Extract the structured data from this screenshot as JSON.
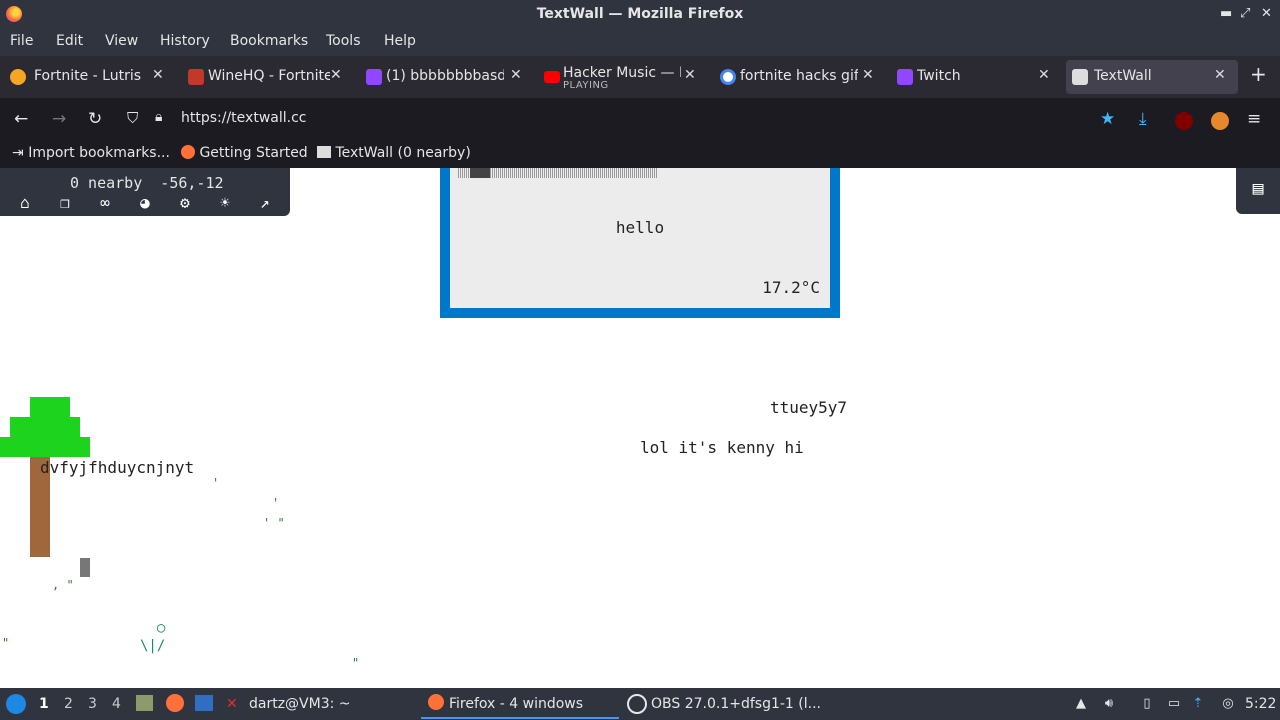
{
  "window": {
    "title": "TextWall — Mozilla Firefox"
  },
  "menu": {
    "items": [
      "File",
      "Edit",
      "View",
      "History",
      "Bookmarks",
      "Tools",
      "Help"
    ]
  },
  "tabs": [
    {
      "label": "Fortnite - Lutris",
      "icon": "lutris-icon",
      "color": "#f5a623"
    },
    {
      "label": "WineHQ - Fortnite",
      "icon": "winehq-icon",
      "color": "#c0392b"
    },
    {
      "label": "(1) bbbbbbbbasdf",
      "icon": "twitch-icon",
      "color": "#9146ff"
    },
    {
      "label": "Hacker Music — D",
      "sub": "PLAYING",
      "icon": "youtube-icon",
      "color": "#ff0000"
    },
    {
      "label": "fortnite hacks gif",
      "icon": "google-icon",
      "color": "#4285f4"
    },
    {
      "label": "Twitch",
      "icon": "twitch-icon",
      "color": "#9146ff"
    },
    {
      "label": "TextWall",
      "icon": "textwall-icon",
      "color": "#dddddd",
      "active": true
    }
  ],
  "nav": {
    "url": "https://textwall.cc"
  },
  "bookmarks": [
    {
      "label": "Import bookmarks...",
      "icon": "import-icon"
    },
    {
      "label": "Getting Started",
      "icon": "firefox-icon"
    },
    {
      "label": "TextWall (0 nearby)",
      "icon": "textwall-icon"
    }
  ],
  "page": {
    "hud": {
      "status": "0 nearby  -56,-12"
    },
    "weather": {
      "text": "hello",
      "temp": "17.2°C"
    },
    "texts": {
      "t1": "ttuey5y7",
      "t2": "lol it's kenny hi",
      "t3": "dvfyjfhduycnjnyt"
    },
    "flower": "  ○\n\\|/"
  },
  "taskbar": {
    "workspaces": [
      "1",
      "2",
      "3",
      "4"
    ],
    "terminal": "dartz@VM3: ~",
    "firefox": "Firefox - 4 windows",
    "obs": "OBS 27.0.1+dfsg1-1 (l...",
    "clock": "5:22"
  },
  "colors": {
    "accent": "#0077c8",
    "tree_green": "#1ed31e",
    "tree_trunk": "#a0663c",
    "chrome_dark": "#2f343f"
  }
}
